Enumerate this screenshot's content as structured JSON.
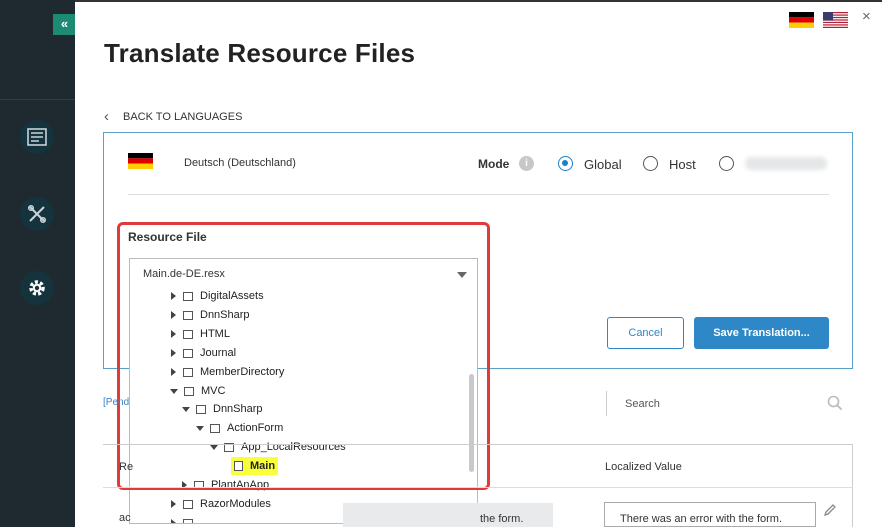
{
  "header": {
    "title": "Translate Resource Files",
    "collapse_label": "«",
    "close_label": "×"
  },
  "back": {
    "label": "BACK TO LANGUAGES"
  },
  "language": {
    "name": "Deutsch (Deutschland)"
  },
  "mode": {
    "label": "Mode",
    "info_label": "i",
    "options": [
      {
        "label": "Global",
        "checked": true
      },
      {
        "label": "Host",
        "checked": false
      }
    ]
  },
  "resource_file": {
    "label": "Resource File",
    "selected": "Main.de-DE.resx",
    "tree": [
      {
        "label": "DigitalAssets",
        "level": 0,
        "state": "collapsed",
        "kind": "folder"
      },
      {
        "label": "DnnSharp",
        "level": 0,
        "state": "collapsed",
        "kind": "folder"
      },
      {
        "label": "HTML",
        "level": 0,
        "state": "collapsed",
        "kind": "folder"
      },
      {
        "label": "Journal",
        "level": 0,
        "state": "collapsed",
        "kind": "folder"
      },
      {
        "label": "MemberDirectory",
        "level": 0,
        "state": "collapsed",
        "kind": "folder"
      },
      {
        "label": "MVC",
        "level": 0,
        "state": "expanded",
        "kind": "folder"
      },
      {
        "label": "DnnSharp",
        "level": 1,
        "state": "expanded",
        "kind": "folder"
      },
      {
        "label": "ActionForm",
        "level": 2,
        "state": "expanded",
        "kind": "folder"
      },
      {
        "label": "App_LocalResources",
        "level": 3,
        "state": "expanded",
        "kind": "folder"
      },
      {
        "label": "Main",
        "level": 4,
        "state": "leaf",
        "kind": "file",
        "highlighted": true
      },
      {
        "label": "PlantAnApp",
        "level": 0,
        "state": "collapsed",
        "kind": "folder"
      },
      {
        "label": "RazorModules",
        "level": 0,
        "state": "collapsed",
        "kind": "folder"
      }
    ]
  },
  "buttons": {
    "cancel": "Cancel",
    "save": "Save Translation..."
  },
  "filter": {
    "pending_label": "[Pend",
    "search_placeholder": "Search"
  },
  "table": {
    "col_left_partial": "Re",
    "col_localized": "Localized Value",
    "row_left_partial": "ac",
    "row_default_partial": "the form.",
    "row_localized": "There was an error with the form."
  },
  "colors": {
    "sidebar": "#1e2a30",
    "accent": "#2e88c7",
    "highlight": "#f8ff3b",
    "annotation": "#e03b3b"
  }
}
